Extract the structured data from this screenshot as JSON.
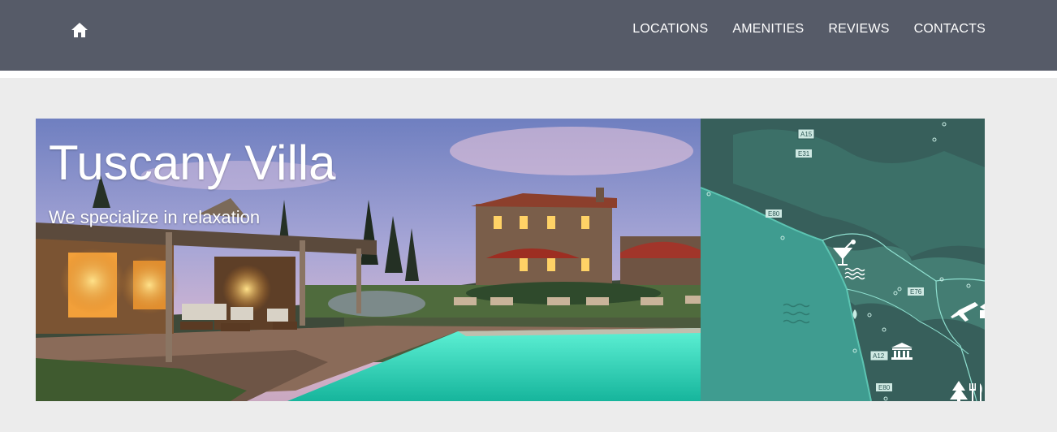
{
  "nav": {
    "home_icon": "home-icon",
    "links": [
      "LOCATIONS",
      "AMENITIES",
      "REVIEWS",
      "CONTACTS"
    ]
  },
  "hero": {
    "title": "Tuscany Villa",
    "subtitle": "We specialize in relaxation"
  },
  "map": {
    "road_labels": [
      "A15",
      "E31",
      "E80",
      "E76",
      "A12",
      "E80"
    ],
    "icons": [
      "cocktail-icon",
      "waves-icon",
      "airplane-icon",
      "museum-icon",
      "tree-icon",
      "restaurant-icon",
      "pin-icon"
    ]
  },
  "colors": {
    "navbar": "#565b68",
    "background": "#ececec",
    "map_base": "#2f5a57",
    "map_sea": "#3f9c90",
    "pool": "#37d9c0"
  }
}
